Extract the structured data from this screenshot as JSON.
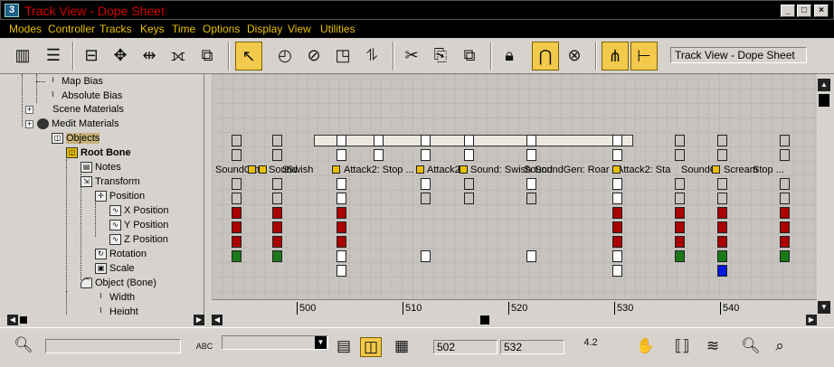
{
  "window": {
    "title": "Track View - Dope Sheet",
    "app_icon": "3"
  },
  "menu": [
    "Modes",
    "Controller",
    "Tracks",
    "Keys",
    "Time",
    "Options",
    "Display",
    "View",
    "Utilities"
  ],
  "toolbar": {
    "title_field": "Track View - Dope Sheet"
  },
  "tree": [
    {
      "label": "Map Bias",
      "icon": "curve-icon"
    },
    {
      "label": "Absolute Bias",
      "icon": "curve-icon"
    },
    {
      "label": "Scene Materials",
      "icon": "none"
    },
    {
      "label": "Medit Materials",
      "icon": "material-icon"
    },
    {
      "label": "Objects",
      "icon": "box-icon"
    },
    {
      "label": "Root Bone",
      "icon": "box-icon"
    },
    {
      "label": "Notes",
      "icon": "notes-icon"
    },
    {
      "label": "Transform",
      "icon": "transform-icon"
    },
    {
      "label": "Position",
      "icon": "position-icon"
    },
    {
      "label": "X Position",
      "icon": "curve-icon"
    },
    {
      "label": "Y Position",
      "icon": "curve-icon"
    },
    {
      "label": "Z Position",
      "icon": "curve-icon"
    },
    {
      "label": "Rotation",
      "icon": "rotation-icon"
    },
    {
      "label": "Scale",
      "icon": "scale-icon"
    },
    {
      "label": "Object (Bone)",
      "icon": "bone-icon"
    },
    {
      "label": "Width",
      "icon": "curve-icon"
    },
    {
      "label": "Height",
      "icon": "curve-icon"
    }
  ],
  "note_labels": [
    "SoundG",
    "Att",
    "Sound",
    "S",
    "Swish",
    "Attack2: Stop ...",
    "Attack2",
    "H",
    "Sound: Swish",
    "Sound",
    "SoundGen: Roar",
    "Attack2: Sta",
    "SoundG",
    "Hi",
    "Scream",
    "Stop ..."
  ],
  "ruler": [
    "500",
    "510",
    "520",
    "530",
    "540"
  ],
  "status": {
    "field_left": "",
    "field_mid": "",
    "start_frame": "502",
    "end_frame": "532",
    "value": "4.2",
    "abc_label": "ABC"
  },
  "colors": {
    "key_red": "#aa0000",
    "key_green": "#1a7a1a",
    "key_blue": "#0018e0",
    "selection": "#c8b27a",
    "title_red": "#d20000",
    "menu_gold": "#e8c000",
    "active_tool": "#f2c94a"
  }
}
